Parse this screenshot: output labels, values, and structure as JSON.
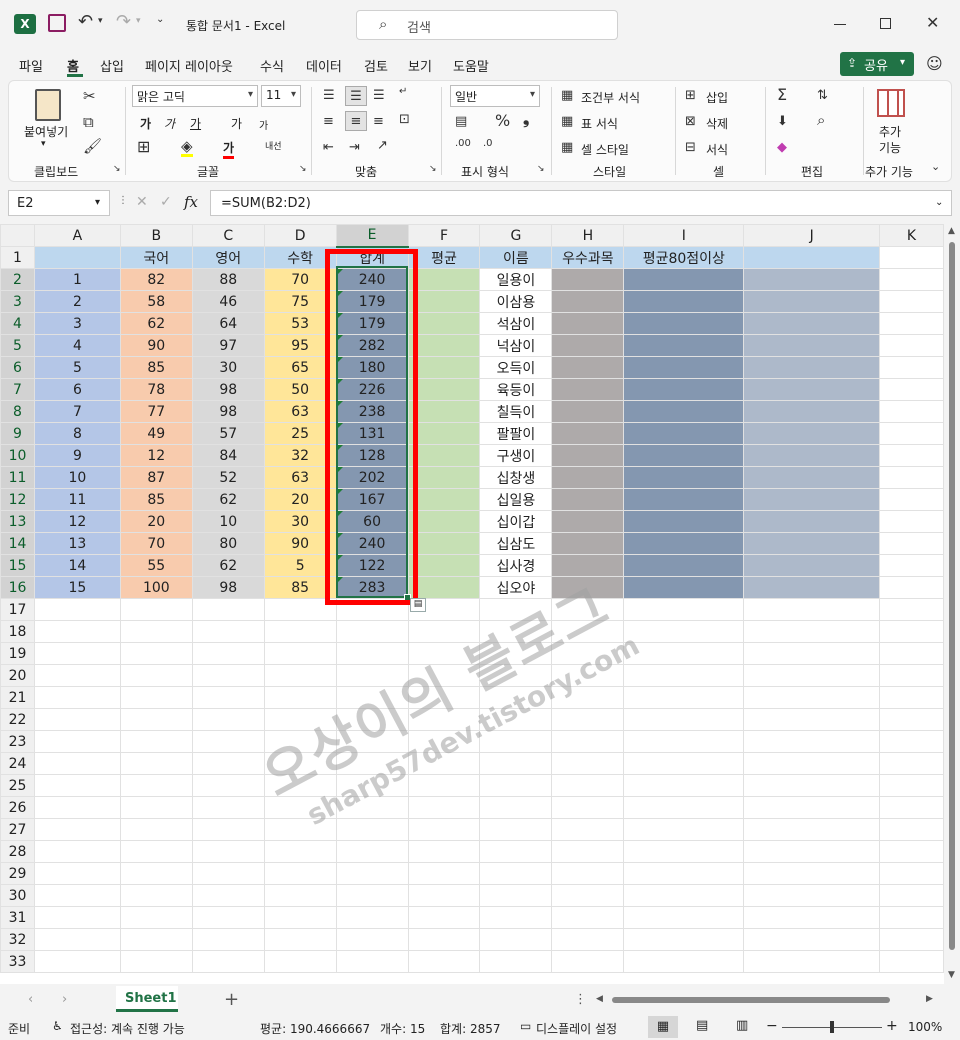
{
  "titlebar": {
    "title": "통합 문서1  -  Excel",
    "search_placeholder": "검색"
  },
  "menu": {
    "tabs": [
      "파일",
      "홈",
      "삽입",
      "페이지 레이아웃",
      "수식",
      "데이터",
      "검토",
      "보기",
      "도움말"
    ],
    "share_label": "공유"
  },
  "ribbon": {
    "clipboard": {
      "paste_label": "붙여넣기",
      "group_label": "클립보드"
    },
    "font": {
      "font_name": "맑은 고딕",
      "font_size": "11",
      "group_label": "글꼴",
      "bold": "가",
      "italic": "가",
      "underline": "가",
      "grow": "가",
      "shrink": "가",
      "font_color": "가",
      "phonetic": "내선"
    },
    "align": {
      "group_label": "맞춤"
    },
    "number": {
      "format": "일반",
      "group_label": "표시 형식"
    },
    "styles": {
      "cond_format": "조건부 서식",
      "table_format": "표 서식",
      "cell_style": "셀 스타일",
      "group_label": "스타일"
    },
    "cells": {
      "insert": "삽입",
      "delete": "삭제",
      "format": "서식",
      "group_label": "셀"
    },
    "edit": {
      "group_label": "편집"
    },
    "addin": {
      "label_1": "추가",
      "label_2": "기능",
      "group_label": "추가 기능"
    }
  },
  "formulabar": {
    "name_box": "E2",
    "fx": "fx",
    "formula": "=SUM(B2:D2)"
  },
  "sheet": {
    "columns": [
      "A",
      "B",
      "C",
      "D",
      "E",
      "F",
      "G",
      "H",
      "I",
      "J",
      "K"
    ],
    "header_row": [
      "",
      "국어",
      "영어",
      "수학",
      "합계",
      "평균",
      "이름",
      "우수과목",
      "평균80점이상",
      ""
    ],
    "rows": [
      [
        "1",
        "82",
        "88",
        "70",
        "240",
        "",
        "일용이",
        "",
        "",
        ""
      ],
      [
        "2",
        "58",
        "46",
        "75",
        "179",
        "",
        "이삼용",
        "",
        "",
        ""
      ],
      [
        "3",
        "62",
        "64",
        "53",
        "179",
        "",
        "석삼이",
        "",
        "",
        ""
      ],
      [
        "4",
        "90",
        "97",
        "95",
        "282",
        "",
        "넉삼이",
        "",
        "",
        ""
      ],
      [
        "5",
        "85",
        "30",
        "65",
        "180",
        "",
        "오득이",
        "",
        "",
        ""
      ],
      [
        "6",
        "78",
        "98",
        "50",
        "226",
        "",
        "육등이",
        "",
        "",
        ""
      ],
      [
        "7",
        "77",
        "98",
        "63",
        "238",
        "",
        "칠득이",
        "",
        "",
        ""
      ],
      [
        "8",
        "49",
        "57",
        "25",
        "131",
        "",
        "팔팔이",
        "",
        "",
        ""
      ],
      [
        "9",
        "12",
        "84",
        "32",
        "128",
        "",
        "구생이",
        "",
        "",
        ""
      ],
      [
        "10",
        "87",
        "52",
        "63",
        "202",
        "",
        "십창생",
        "",
        "",
        ""
      ],
      [
        "11",
        "85",
        "62",
        "20",
        "167",
        "",
        "십일용",
        "",
        "",
        ""
      ],
      [
        "12",
        "20",
        "10",
        "30",
        "60",
        "",
        "십이갑",
        "",
        "",
        ""
      ],
      [
        "13",
        "70",
        "80",
        "90",
        "240",
        "",
        "십삼도",
        "",
        "",
        ""
      ],
      [
        "14",
        "55",
        "62",
        "5",
        "122",
        "",
        "십사경",
        "",
        "",
        ""
      ],
      [
        "15",
        "100",
        "98",
        "85",
        "283",
        "",
        "십오야",
        "",
        "",
        ""
      ]
    ],
    "total_rows": 33
  },
  "watermark": {
    "line1": "오상이의 블로그",
    "line2": "sharp57dev.tistory.com"
  },
  "sheetbar": {
    "sheet_name": "Sheet1",
    "add": "+"
  },
  "status": {
    "ready": "준비",
    "accessibility": "접근성: 계속 진행 가능",
    "average": "평균: 190.4666667",
    "count": "개수: 15",
    "sum": "합계: 2857",
    "display": "디스플레이 설정",
    "zoom": "100%"
  },
  "colors": {
    "excel_green": "#217346",
    "highlight_red": "#ff0000"
  }
}
